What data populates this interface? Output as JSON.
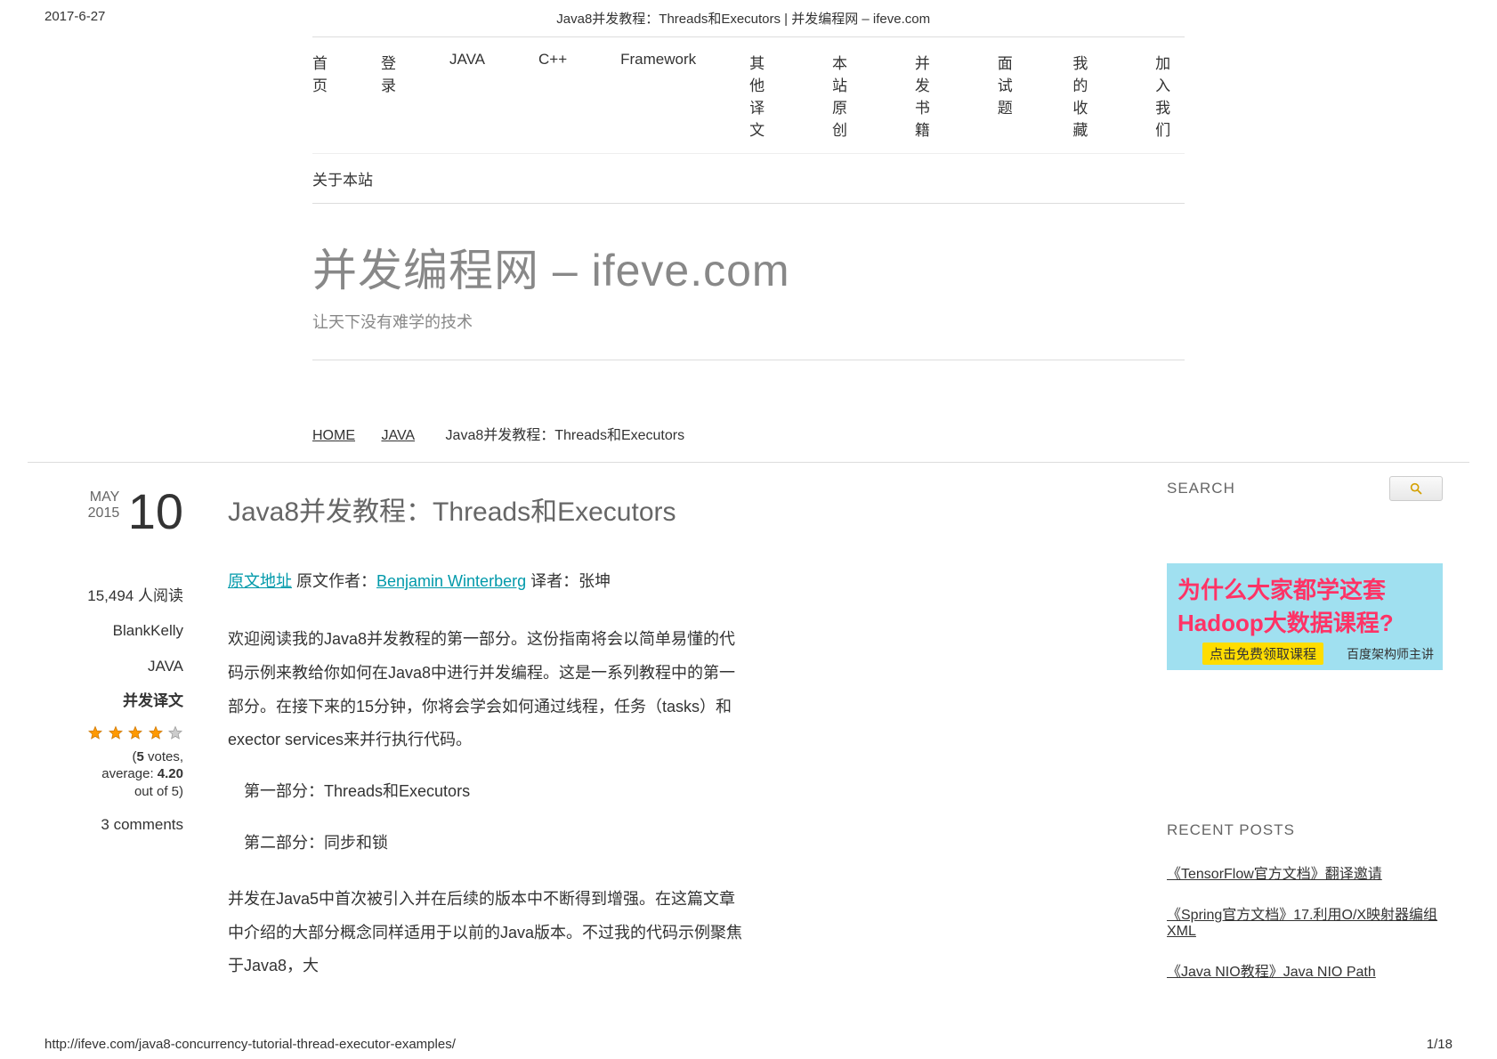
{
  "meta": {
    "date": "2017-6-27",
    "page_title": "Java8并发教程：Threads和Executors | 并发编程网 – ifeve.com"
  },
  "nav": {
    "row1": [
      "首页",
      "登录",
      "JAVA",
      "C++",
      "Framework",
      "其他译文",
      "本站原创",
      "并发书籍",
      "面试题",
      "我的收藏",
      "加入我们"
    ],
    "row2": [
      "关于本站"
    ]
  },
  "site": {
    "title": "并发编程网 – ifeve.com",
    "tagline": "让天下没有难学的技术"
  },
  "breadcrumb": {
    "home": "HOME",
    "cat": "JAVA",
    "current": "Java8并发教程：Threads和Executors"
  },
  "post_date": {
    "month": "MAY",
    "year": "2015",
    "day": "10"
  },
  "post_meta": {
    "reads": "15,494 人阅读",
    "author": "BlankKelly",
    "category": "JAVA",
    "tag": "并发译文"
  },
  "rating": {
    "text_open": "(",
    "votes_num": "5",
    "votes_label": " votes,",
    "avg_label": "average: ",
    "avg_num": "4.20",
    "outof": "out of 5)"
  },
  "comments": "3 comments",
  "article": {
    "title": "Java8并发教程：Threads和Executors",
    "link_original": "原文地址",
    "author_prefix": "  原文作者：",
    "author_link": "Benjamin Winterberg",
    "translator": " 译者：张坤",
    "p1": "欢迎阅读我的Java8并发教程的第一部分。这份指南将会以简单易懂的代码示例来教给你如何在Java8中进行并发编程。这是一系列教程中的第一部分。在接下来的15分钟，你将会学会如何通过线程，任务（tasks）和 exector services来并行执行代码。",
    "part1": "第一部分：Threads和Executors",
    "part2": "第二部分：同步和锁",
    "p2": "并发在Java5中首次被引入并在后续的版本中不断得到增强。在这篇文章中介绍的大部分概念同样适用于以前的Java版本。不过我的代码示例聚焦于Java8，大"
  },
  "search": {
    "label": "SEARCH"
  },
  "ad": {
    "line1": "为什么大家都学这套",
    "line2": "Hadoop大数据课程?",
    "btn": "点击免费领取课程",
    "sub": "百度架构师主讲"
  },
  "recent": {
    "heading": "RECENT POSTS",
    "items": [
      "《TensorFlow官方文档》翻译邀请",
      "《Spring官方文档》17.利用O/X映射器编组XML",
      "《Java NIO教程》Java NIO Path"
    ]
  },
  "footer": {
    "url": "http://ifeve.com/java8-concurrency-tutorial-thread-executor-examples/",
    "page": "1/18"
  }
}
